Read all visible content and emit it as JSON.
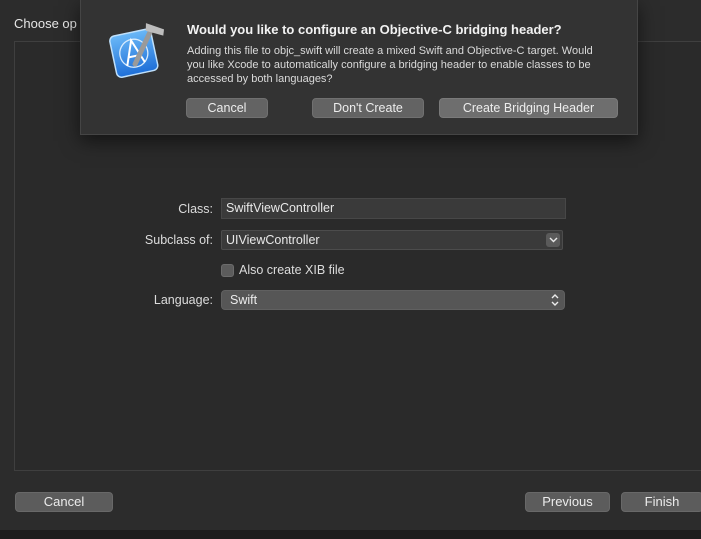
{
  "window": {
    "header_label": "Choose op"
  },
  "form": {
    "class_label": "Class:",
    "class_value": "SwiftViewController",
    "subclass_label": "Subclass of:",
    "subclass_value": "UIViewController",
    "xib_label": "Also create XIB file",
    "xib_checked": false,
    "language_label": "Language:",
    "language_value": "Swift"
  },
  "footer": {
    "cancel_label": "Cancel",
    "previous_label": "Previous",
    "finish_label": "Finish"
  },
  "sheet": {
    "title": "Would you like to configure an Objective-C bridging header?",
    "message": "Adding this file to objc_swift will create a mixed Swift and Objective-C target. Would you like Xcode to automatically configure a bridging header to enable classes to be accessed by both languages?",
    "icon": "xcode-app-icon",
    "cancel_label": "Cancel",
    "dont_create_label": "Don't Create",
    "create_label": "Create Bridging Header"
  }
}
